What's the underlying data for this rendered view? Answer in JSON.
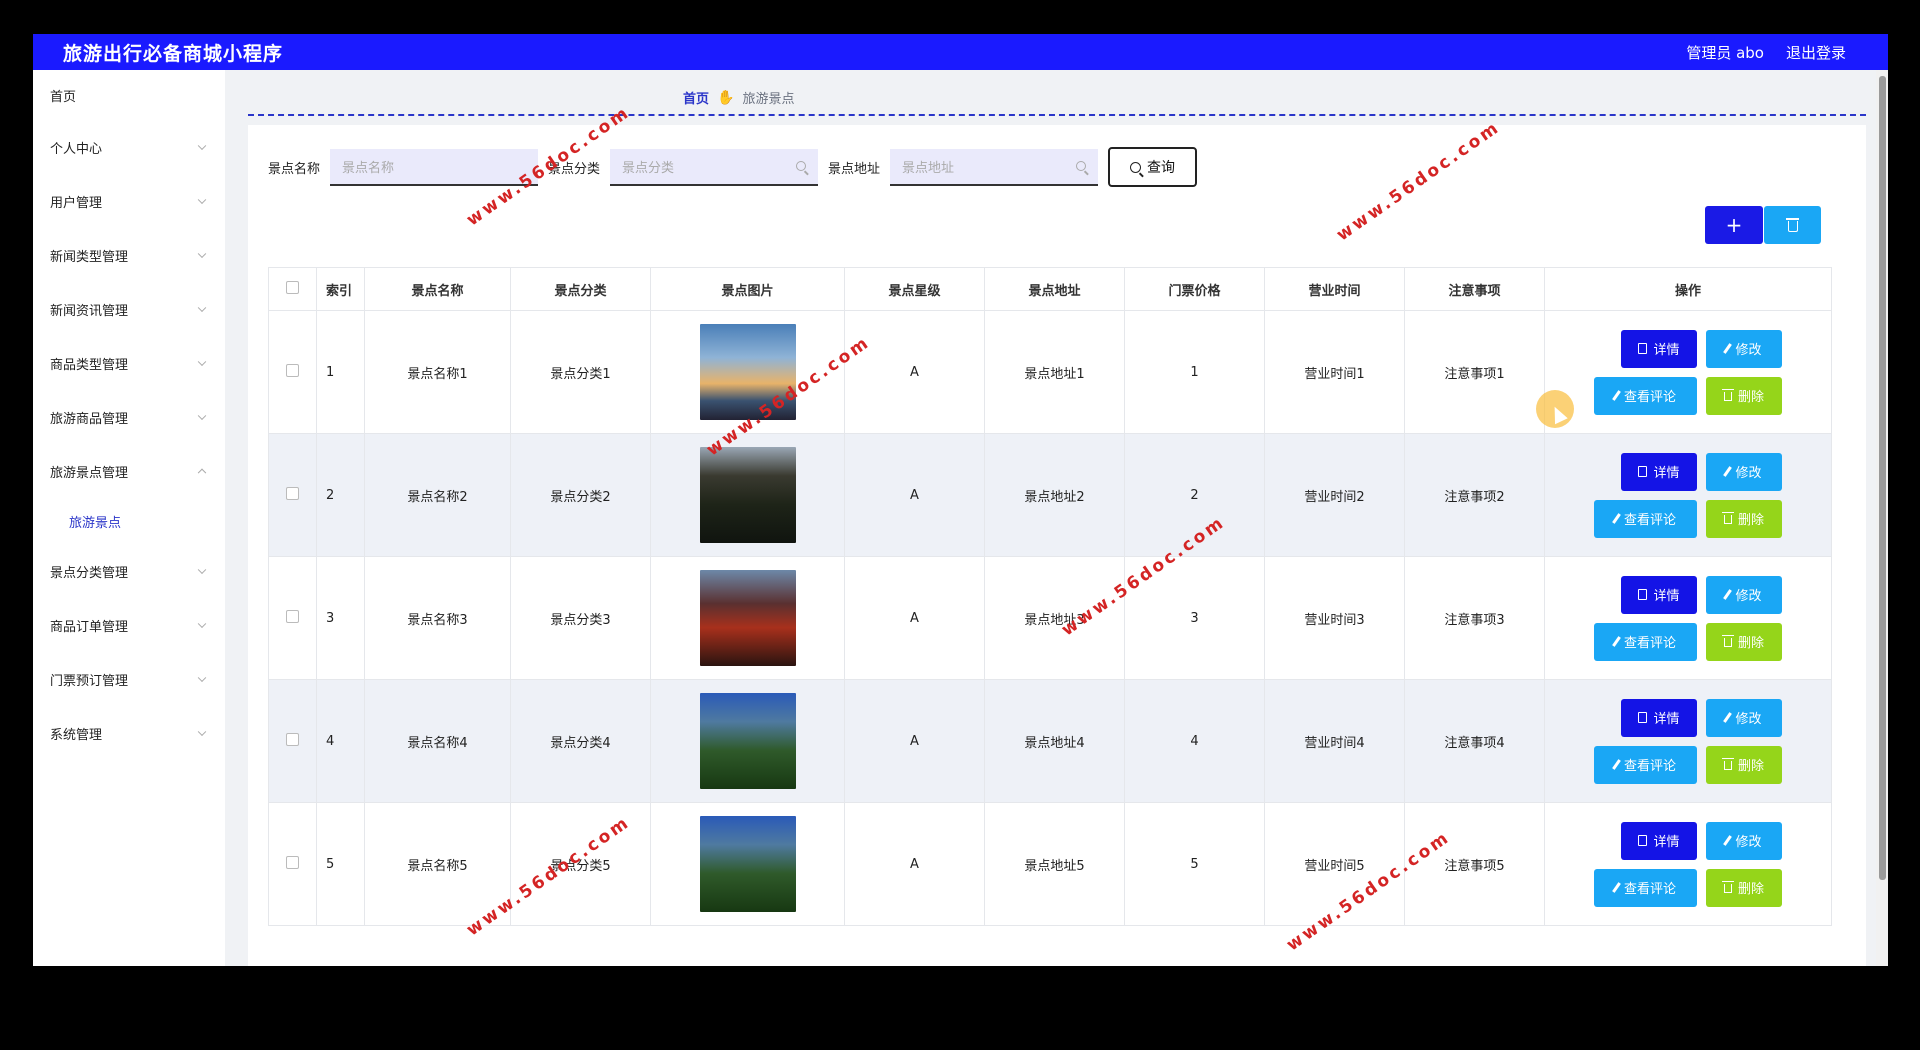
{
  "header": {
    "title": "旅游出行必备商城小程序",
    "admin": "管理员 abo",
    "logout": "退出登录"
  },
  "sidebar": {
    "items": [
      {
        "label": "首页"
      },
      {
        "label": "个人中心"
      },
      {
        "label": "用户管理"
      },
      {
        "label": "新闻类型管理"
      },
      {
        "label": "新闻资讯管理"
      },
      {
        "label": "商品类型管理"
      },
      {
        "label": "旅游商品管理"
      },
      {
        "label": "旅游景点管理"
      },
      {
        "label": "旅游景点"
      },
      {
        "label": "景点分类管理"
      },
      {
        "label": "商品订单管理"
      },
      {
        "label": "门票预订管理"
      },
      {
        "label": "系统管理"
      }
    ]
  },
  "breadcrumb": {
    "home": "首页",
    "current": "旅游景点"
  },
  "search": {
    "name_label": "景点名称",
    "name_placeholder": "景点名称",
    "category_label": "景点分类",
    "category_placeholder": "景点分类",
    "address_label": "景点地址",
    "address_placeholder": "景点地址",
    "query_label": "查询"
  },
  "toolbar": {
    "add_label": "+"
  },
  "table": {
    "headers": [
      "索引",
      "景点名称",
      "景点分类",
      "景点图片",
      "景点星级",
      "景点地址",
      "门票价格",
      "营业时间",
      "注意事项",
      "操作"
    ],
    "rows": [
      {
        "index": "1",
        "name": "景点名称1",
        "category": "景点分类1",
        "stars": "A",
        "address": "景点地址1",
        "price": "1",
        "hours": "营业时间1",
        "notes": "注意事项1"
      },
      {
        "index": "2",
        "name": "景点名称2",
        "category": "景点分类2",
        "stars": "A",
        "address": "景点地址2",
        "price": "2",
        "hours": "营业时间2",
        "notes": "注意事项2"
      },
      {
        "index": "3",
        "name": "景点名称3",
        "category": "景点分类3",
        "stars": "A",
        "address": "景点地址3",
        "price": "3",
        "hours": "营业时间3",
        "notes": "注意事项3"
      },
      {
        "index": "4",
        "name": "景点名称4",
        "category": "景点分类4",
        "stars": "A",
        "address": "景点地址4",
        "price": "4",
        "hours": "营业时间4",
        "notes": "注意事项4"
      },
      {
        "index": "5",
        "name": "景点名称5",
        "category": "景点分类5",
        "stars": "A",
        "address": "景点地址5",
        "price": "5",
        "hours": "营业时间5",
        "notes": "注意事项5"
      }
    ],
    "actions": {
      "detail": "详情",
      "edit": "修改",
      "comments": "查看评论",
      "delete": "删除"
    }
  },
  "watermark": "www.56doc.com",
  "colors": {
    "header_bg": "#1a1aff",
    "detail_btn": "#1414e6",
    "edit_btn": "#1aa7f5",
    "delete_btn": "#95d51a",
    "accent_text": "#2b36c9"
  }
}
